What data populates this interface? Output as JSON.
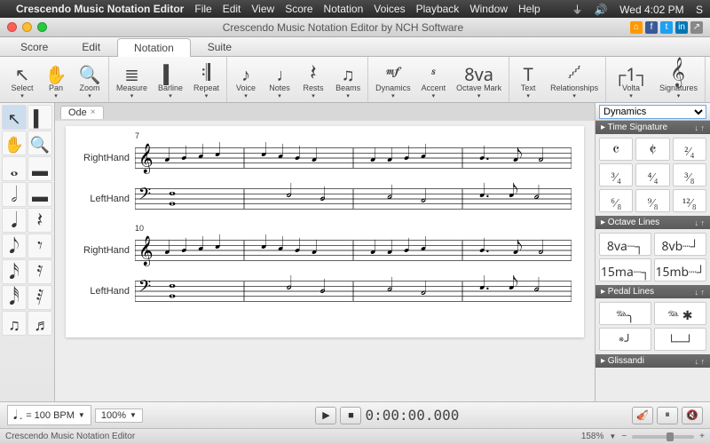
{
  "menubar": {
    "app": "Crescendo Music Notation Editor",
    "items": [
      "File",
      "Edit",
      "View",
      "Score",
      "Notation",
      "Voices",
      "Playback",
      "Window",
      "Help"
    ],
    "clock": "Wed 4:02 PM",
    "user": "S"
  },
  "window": {
    "title": "Crescendo Music Notation Editor by NCH Software"
  },
  "tabs": {
    "items": [
      "Score",
      "Edit",
      "Notation",
      "Suite"
    ],
    "active": 2
  },
  "toolbar": {
    "groups": [
      [
        {
          "icon": "↖",
          "label": "Select"
        },
        {
          "icon": "✋",
          "label": "Pan"
        },
        {
          "icon": "🔍",
          "label": "Zoom"
        }
      ],
      [
        {
          "icon": "≣",
          "label": "Measure"
        },
        {
          "icon": "▍",
          "label": "Barline"
        },
        {
          "icon": "𝄇",
          "label": "Repeat"
        }
      ],
      [
        {
          "icon": "♪",
          "label": "Voice"
        },
        {
          "icon": "♩",
          "label": "Notes"
        },
        {
          "icon": "𝄽",
          "label": "Rests"
        },
        {
          "icon": "♫",
          "label": "Beams"
        }
      ],
      [
        {
          "icon": "𝆐𝆑",
          "label": "Dynamics"
        },
        {
          "icon": "𝆍",
          "label": "Accent"
        },
        {
          "icon": "8va",
          "label": "Octave Mark"
        }
      ],
      [
        {
          "icon": "T",
          "label": "Text"
        },
        {
          "icon": "𝆱",
          "label": "Relationships"
        }
      ],
      [
        {
          "icon": "┌1┐",
          "label": "Volta"
        },
        {
          "icon": "𝄞",
          "label": "Signatures"
        }
      ]
    ]
  },
  "leftpanel": {
    "rows": [
      [
        "↖",
        "▍"
      ],
      [
        "✋",
        "🔍"
      ],
      [
        "𝅝",
        "▬"
      ],
      [
        "𝅗𝅥",
        "▬"
      ],
      [
        "𝅘𝅥",
        "𝄽"
      ],
      [
        "𝅘𝅥𝅮",
        "𝄾"
      ],
      [
        "𝅘𝅥𝅯",
        "𝄿"
      ],
      [
        "𝅘𝅥𝅰",
        "𝅀"
      ],
      [
        "♫",
        "♬"
      ]
    ]
  },
  "doc": {
    "tab_name": "Ode"
  },
  "score": {
    "systems": [
      {
        "measure_start": 7,
        "staves": [
          {
            "label": "RightHand",
            "clef": "treble"
          },
          {
            "label": "LeftHand",
            "clef": "bass"
          }
        ]
      },
      {
        "measure_start": 10,
        "staves": [
          {
            "label": "RightHand",
            "clef": "treble"
          },
          {
            "label": "LeftHand",
            "clef": "bass"
          }
        ]
      }
    ]
  },
  "rightpanel": {
    "dropdown": "Dynamics",
    "sections": [
      {
        "title": "Time Signature",
        "cols": 3,
        "cells": [
          "𝄴",
          "𝄵",
          "²⁄₄",
          "³⁄₄",
          "⁴⁄₄",
          "³⁄₈",
          "⁶⁄₈",
          "⁹⁄₈",
          "¹²⁄₈"
        ]
      },
      {
        "title": "Octave Lines",
        "cols": 2,
        "cells": [
          "8va┈┐",
          "8vb┈┘",
          "15ma┈┐",
          "15mb┈┘"
        ]
      },
      {
        "title": "Pedal Lines",
        "cols": 2,
        "cells": [
          "𝆮╮",
          "𝆮 ✱",
          "𝆯╯",
          "└─┘"
        ]
      },
      {
        "title": "Glissandi",
        "cols": 2,
        "cells": []
      }
    ]
  },
  "transport": {
    "tempo_label": "= 100 BPM",
    "tempo_glyph": "𝅘𝅥 .",
    "zoom": "100%",
    "time": "0:00:00.000"
  },
  "status": {
    "text": "Crescendo Music Notation Editor",
    "zoom_pct": "158%"
  }
}
